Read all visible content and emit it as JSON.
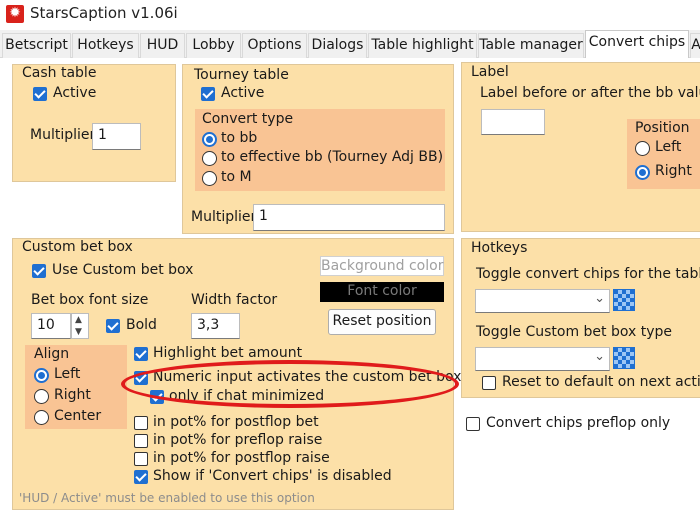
{
  "window": {
    "title": "StarsCaption v1.06i"
  },
  "tabs": [
    "Betscript",
    "Hotkeys",
    "HUD",
    "Lobby",
    "Options",
    "Dialogs",
    "Table highlight",
    "Table manager",
    "Convert chips",
    "A"
  ],
  "active_tab": "Convert chips",
  "cash_table": {
    "title": "Cash table",
    "active_label": "Active",
    "multiplier_label": "Multiplier",
    "multiplier_value": "1"
  },
  "tourney_table": {
    "title": "Tourney table",
    "active_label": "Active",
    "convert_type_title": "Convert type",
    "options": [
      "to bb",
      "to effective bb (Tourney Adj BB)",
      "to M"
    ],
    "selected_option": "to bb",
    "multiplier_label": "Multiplier",
    "multiplier_value": "1"
  },
  "label_group": {
    "title": "Label",
    "description": "Label before or after the bb value",
    "input_value": "",
    "position_title": "Position",
    "options": [
      "Left",
      "Right"
    ],
    "selected": "Right"
  },
  "custom_bet_box": {
    "title": "Custom bet box",
    "use_label": "Use Custom bet box",
    "font_size_label": "Bet box font size",
    "font_size_value": "10",
    "bold_label": "Bold",
    "width_factor_label": "Width factor",
    "width_factor_value": "3,3",
    "background_color_label": "Background color",
    "font_color_label": "Font color",
    "reset_position_label": "Reset position",
    "align_title": "Align",
    "align_options": [
      "Left",
      "Right",
      "Center"
    ],
    "align_selected": "Left",
    "options": [
      {
        "label": "Highlight bet amount",
        "checked": true
      },
      {
        "label": "Numeric input activates the custom bet box",
        "checked": true
      },
      {
        "label": "only if chat minimized",
        "checked": true
      },
      {
        "label": "in pot% for postflop bet",
        "checked": false
      },
      {
        "label": "in pot% for preflop raise",
        "checked": false
      },
      {
        "label": "in pot% for postflop raise",
        "checked": false
      },
      {
        "label": "Show if 'Convert chips' is disabled",
        "checked": true
      }
    ],
    "footer_note": "'HUD / Active' must be enabled to use this option"
  },
  "hotkeys": {
    "title": "Hotkeys",
    "toggle_convert_label": "Toggle convert chips for the table",
    "toggle_custom_label": "Toggle Custom bet box type",
    "reset_label": "Reset to default on next action"
  },
  "convert_preflop_only_label": "Convert chips preflop only",
  "colors": {
    "panel": "#fce0a8",
    "subpanel": "#f9c494",
    "accent": "#1f6fd1",
    "annotation": "#e01b1b"
  }
}
